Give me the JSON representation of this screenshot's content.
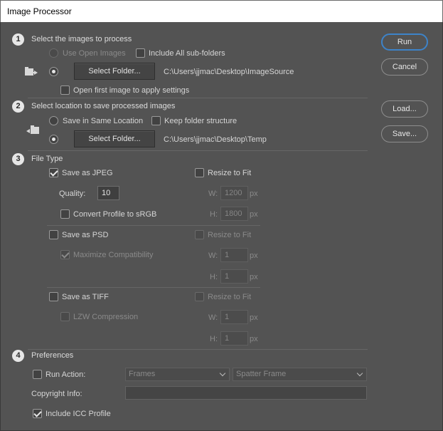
{
  "window": {
    "title": "Image Processor"
  },
  "section1": {
    "number": "1",
    "title": "Select the images to process",
    "use_open_images": "Use Open Images",
    "include_subfolders": "Include All sub-folders",
    "select_folder": "Select Folder...",
    "source_path": "C:\\Users\\jjmac\\Desktop\\ImageSource",
    "open_first_image": "Open first image to apply settings"
  },
  "section2": {
    "number": "2",
    "title": "Select location to save processed images",
    "save_same_location": "Save in Same Location",
    "keep_folder_structure": "Keep folder structure",
    "select_folder": "Select Folder...",
    "dest_path": "C:\\Users\\jjmac\\Desktop\\Temp"
  },
  "section3": {
    "number": "3",
    "title": "File Type",
    "jpeg": {
      "save_as": "Save as JPEG",
      "resize": "Resize to Fit",
      "quality_label": "Quality:",
      "quality_value": "10",
      "w_label": "W:",
      "w_value": "1200",
      "h_label": "H:",
      "h_value": "1800",
      "unit": "px",
      "convert_profile": "Convert Profile to sRGB"
    },
    "psd": {
      "save_as": "Save as PSD",
      "resize": "Resize to Fit",
      "maximize": "Maximize Compatibility",
      "w_label": "W:",
      "w_value": "1",
      "h_label": "H:",
      "h_value": "1",
      "unit": "px"
    },
    "tiff": {
      "save_as": "Save as TIFF",
      "resize": "Resize to Fit",
      "lzw": "LZW Compression",
      "w_label": "W:",
      "w_value": "1",
      "h_label": "H:",
      "h_value": "1",
      "unit": "px"
    }
  },
  "section4": {
    "number": "4",
    "title": "Preferences",
    "run_action": "Run Action:",
    "action_set": "Frames",
    "action_name": "Spatter Frame",
    "copyright_label": "Copyright Info:",
    "copyright_value": "",
    "include_icc": "Include ICC Profile"
  },
  "buttons": {
    "run": "Run",
    "cancel": "Cancel",
    "load": "Load...",
    "save": "Save..."
  },
  "colors": {
    "background": "#535353",
    "primary_border": "#3d83c9"
  }
}
